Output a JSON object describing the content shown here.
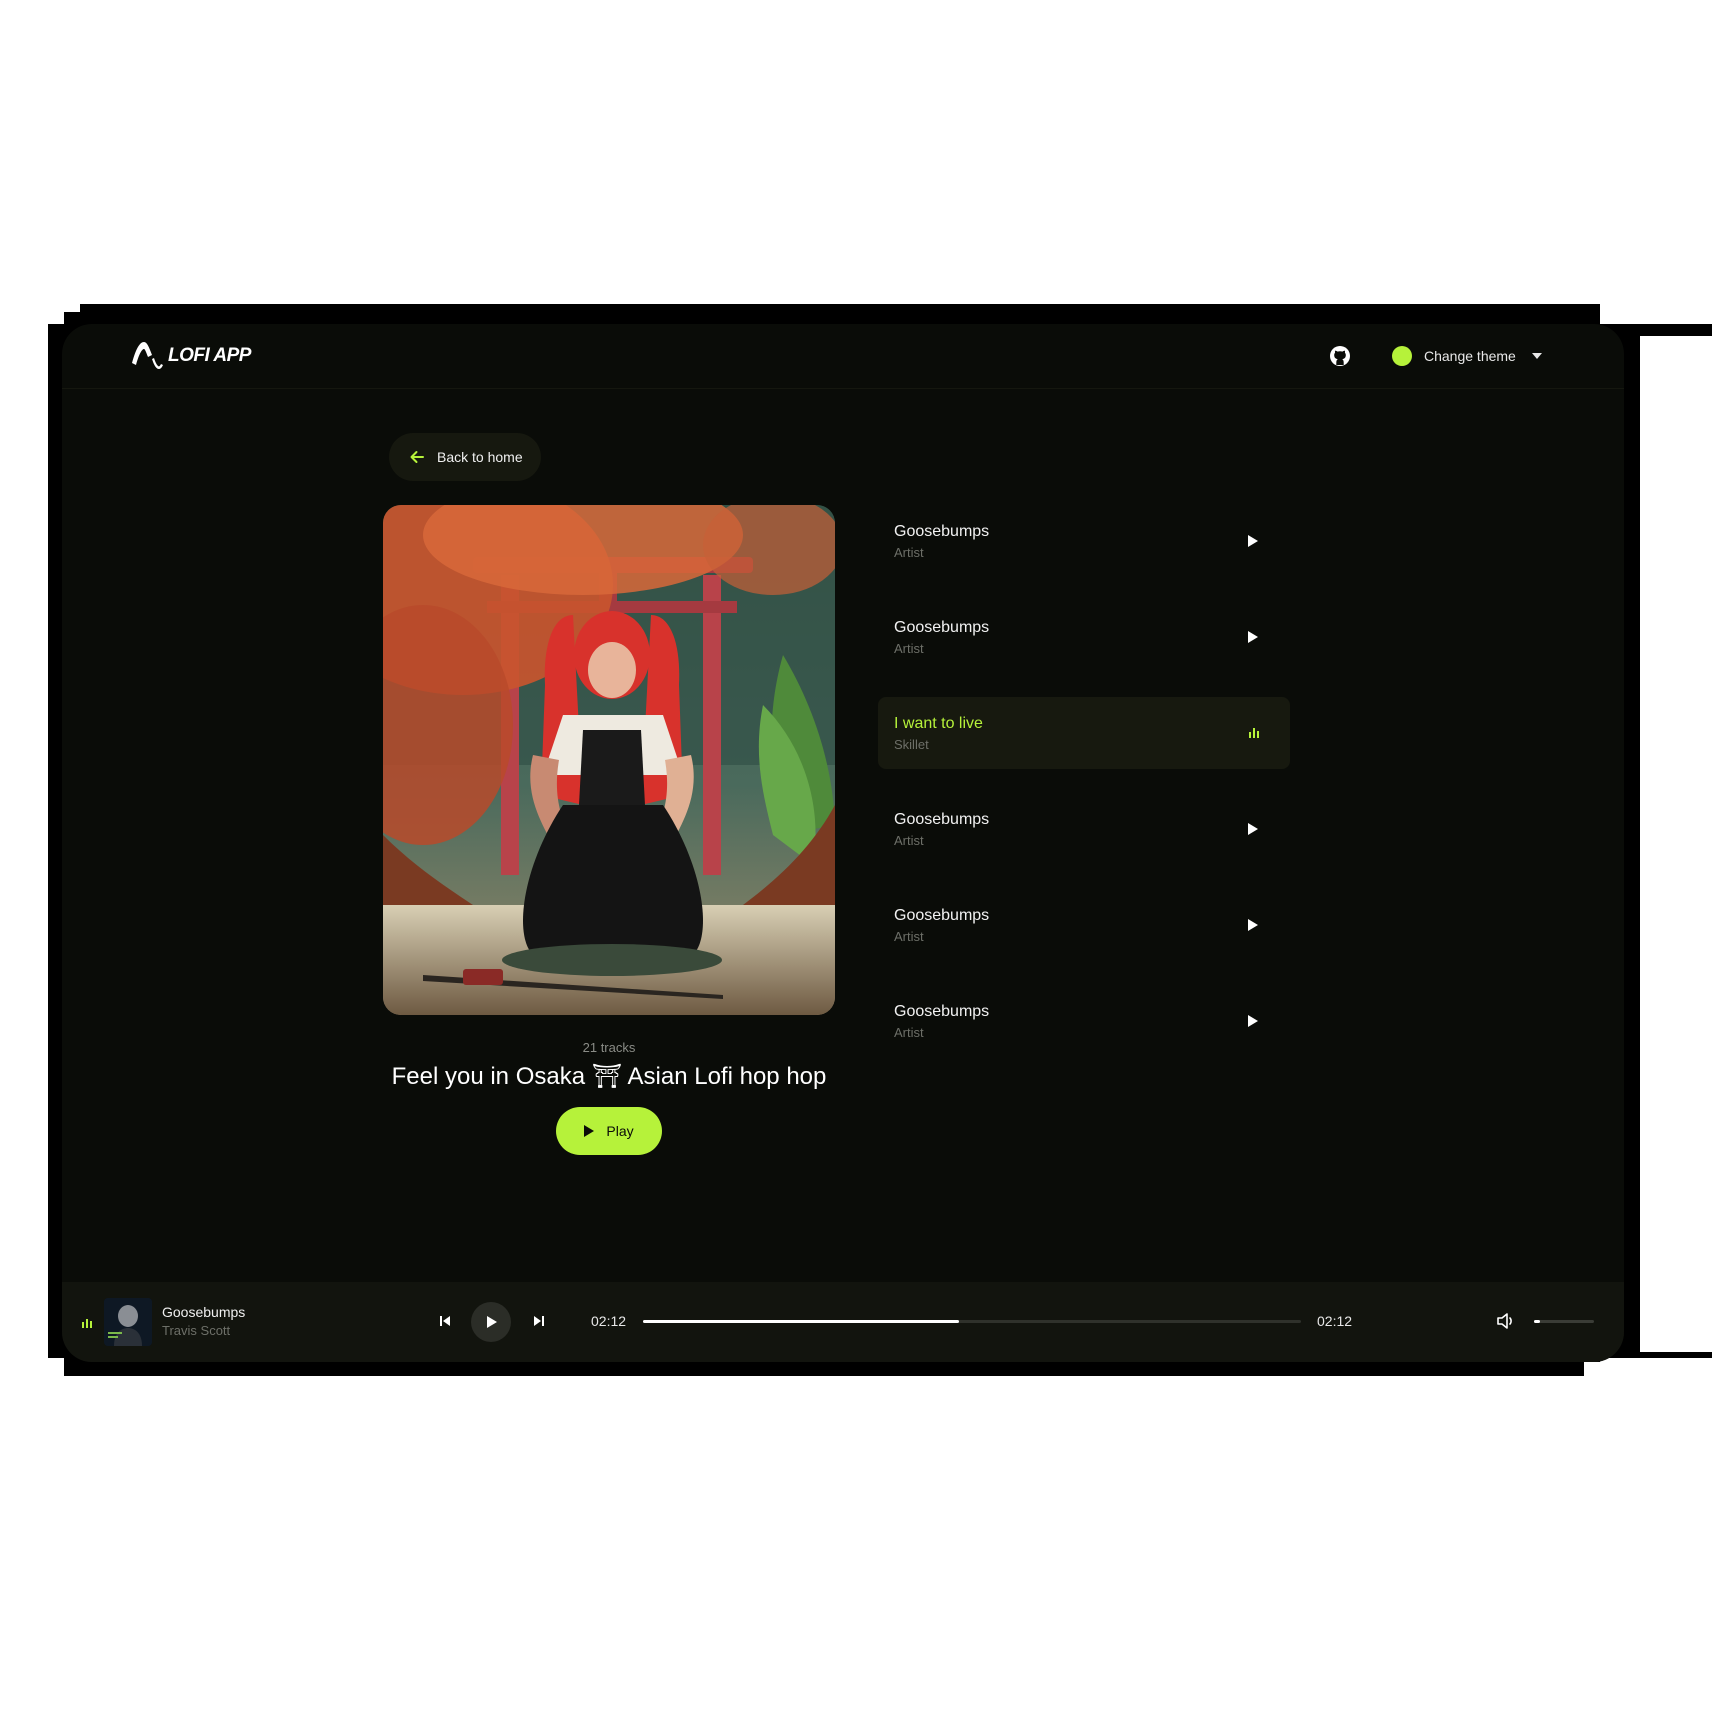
{
  "app": {
    "logo_text": "LOFI APP",
    "accent": "#b6f23a",
    "background": "#0a0c08"
  },
  "header": {
    "github_icon": "github-icon",
    "theme_label": "Change theme",
    "theme_color": "#b6f23a"
  },
  "back": {
    "label": "Back to home"
  },
  "playlist": {
    "tracks_count": "21 tracks",
    "title": "Feel you in Osaka ⛩ Asian Lofi hop hop",
    "play_label": "Play"
  },
  "tracks": [
    {
      "title": "Goosebumps",
      "artist": "Artist",
      "active": false
    },
    {
      "title": "Goosebumps",
      "artist": "Artist",
      "active": false
    },
    {
      "title": "I want to live",
      "artist": "Skillet",
      "active": true
    },
    {
      "title": "Goosebumps",
      "artist": "Artist",
      "active": false
    },
    {
      "title": "Goosebumps",
      "artist": "Artist",
      "active": false
    },
    {
      "title": "Goosebumps",
      "artist": "Artist",
      "active": false
    }
  ],
  "player": {
    "title": "Goosebumps",
    "artist": "Travis Scott",
    "current_time": "02:12",
    "total_time": "02:12",
    "progress": 0.48,
    "volume": 0.1
  }
}
